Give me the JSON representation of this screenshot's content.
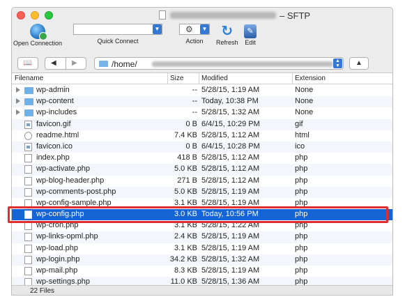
{
  "window": {
    "title_suffix": "– SFTP"
  },
  "toolbar": {
    "open_connection": "Open Connection",
    "quick_connect": "Quick Connect",
    "action": "Action",
    "refresh": "Refresh",
    "edit": "Edit"
  },
  "pathbar": {
    "path": "/home/",
    "bookmarks_icon": "book-icon",
    "back_icon": "back-arrow",
    "forward_icon": "forward-arrow",
    "up_icon": "up-arrow"
  },
  "columns": {
    "filename": "Filename",
    "size": "Size",
    "modified": "Modified",
    "extension": "Extension"
  },
  "files": [
    {
      "name": "wp-admin",
      "size": "--",
      "modified": "5/28/15, 1:19 AM",
      "ext": "None",
      "type": "folder"
    },
    {
      "name": "wp-content",
      "size": "--",
      "modified": "Today, 10:38 PM",
      "ext": "None",
      "type": "folder"
    },
    {
      "name": "wp-includes",
      "size": "--",
      "modified": "5/28/15, 1:32 AM",
      "ext": "None",
      "type": "folder"
    },
    {
      "name": "favicon.gif",
      "size": "0 B",
      "modified": "6/4/15, 10:29 PM",
      "ext": "gif",
      "type": "img"
    },
    {
      "name": "readme.html",
      "size": "7.4 KB",
      "modified": "5/28/15, 1:12 AM",
      "ext": "html",
      "type": "html"
    },
    {
      "name": "favicon.ico",
      "size": "0 B",
      "modified": "6/4/15, 10:28 PM",
      "ext": "ico",
      "type": "img"
    },
    {
      "name": "index.php",
      "size": "418 B",
      "modified": "5/28/15, 1:12 AM",
      "ext": "php",
      "type": "file"
    },
    {
      "name": "wp-activate.php",
      "size": "5.0 KB",
      "modified": "5/28/15, 1:12 AM",
      "ext": "php",
      "type": "file"
    },
    {
      "name": "wp-blog-header.php",
      "size": "271 B",
      "modified": "5/28/15, 1:12 AM",
      "ext": "php",
      "type": "file"
    },
    {
      "name": "wp-comments-post.php",
      "size": "5.0 KB",
      "modified": "5/28/15, 1:19 AM",
      "ext": "php",
      "type": "file"
    },
    {
      "name": "wp-config-sample.php",
      "size": "3.1 KB",
      "modified": "5/28/15, 1:19 AM",
      "ext": "php",
      "type": "file"
    },
    {
      "name": "wp-config.php",
      "size": "3.0 KB",
      "modified": "Today, 10:56 PM",
      "ext": "php",
      "type": "file",
      "selected": true
    },
    {
      "name": "wp-cron.php",
      "size": "3.1 KB",
      "modified": "5/28/15, 1:22 AM",
      "ext": "php",
      "type": "file"
    },
    {
      "name": "wp-links-opml.php",
      "size": "2.4 KB",
      "modified": "5/28/15, 1:19 AM",
      "ext": "php",
      "type": "file"
    },
    {
      "name": "wp-load.php",
      "size": "3.1 KB",
      "modified": "5/28/15, 1:19 AM",
      "ext": "php",
      "type": "file"
    },
    {
      "name": "wp-login.php",
      "size": "34.2 KB",
      "modified": "5/28/15, 1:32 AM",
      "ext": "php",
      "type": "file"
    },
    {
      "name": "wp-mail.php",
      "size": "8.3 KB",
      "modified": "5/28/15, 1:19 AM",
      "ext": "php",
      "type": "file"
    },
    {
      "name": "wp-settings.php",
      "size": "11.0 KB",
      "modified": "5/28/15, 1:36 AM",
      "ext": "php",
      "type": "file"
    }
  ],
  "status": {
    "count": "22 Files"
  },
  "colors": {
    "selection": "#1464d6",
    "highlight_box": "#e22d2d",
    "accent": "#3478d6"
  }
}
